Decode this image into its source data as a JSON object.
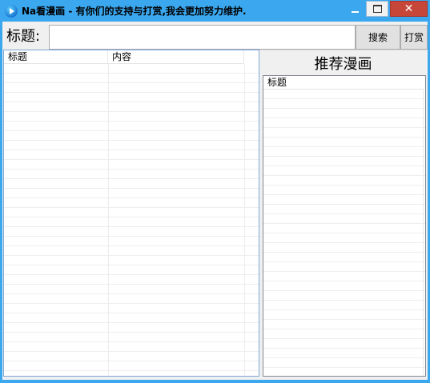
{
  "window": {
    "title": "Na看漫画 - 有你们的支持与打赏,我会更加努力维护.",
    "icon": "app-play-icon",
    "accent_color": "#3aa7ee",
    "close_color": "#c7463a"
  },
  "search": {
    "label": "标题:",
    "value": "",
    "search_button": "搜索",
    "reward_button": "打赏"
  },
  "results": {
    "columns": [
      "标题",
      "内容"
    ],
    "rows": []
  },
  "recommend": {
    "heading": "推荐漫画",
    "columns": [
      "标题"
    ],
    "rows": []
  }
}
